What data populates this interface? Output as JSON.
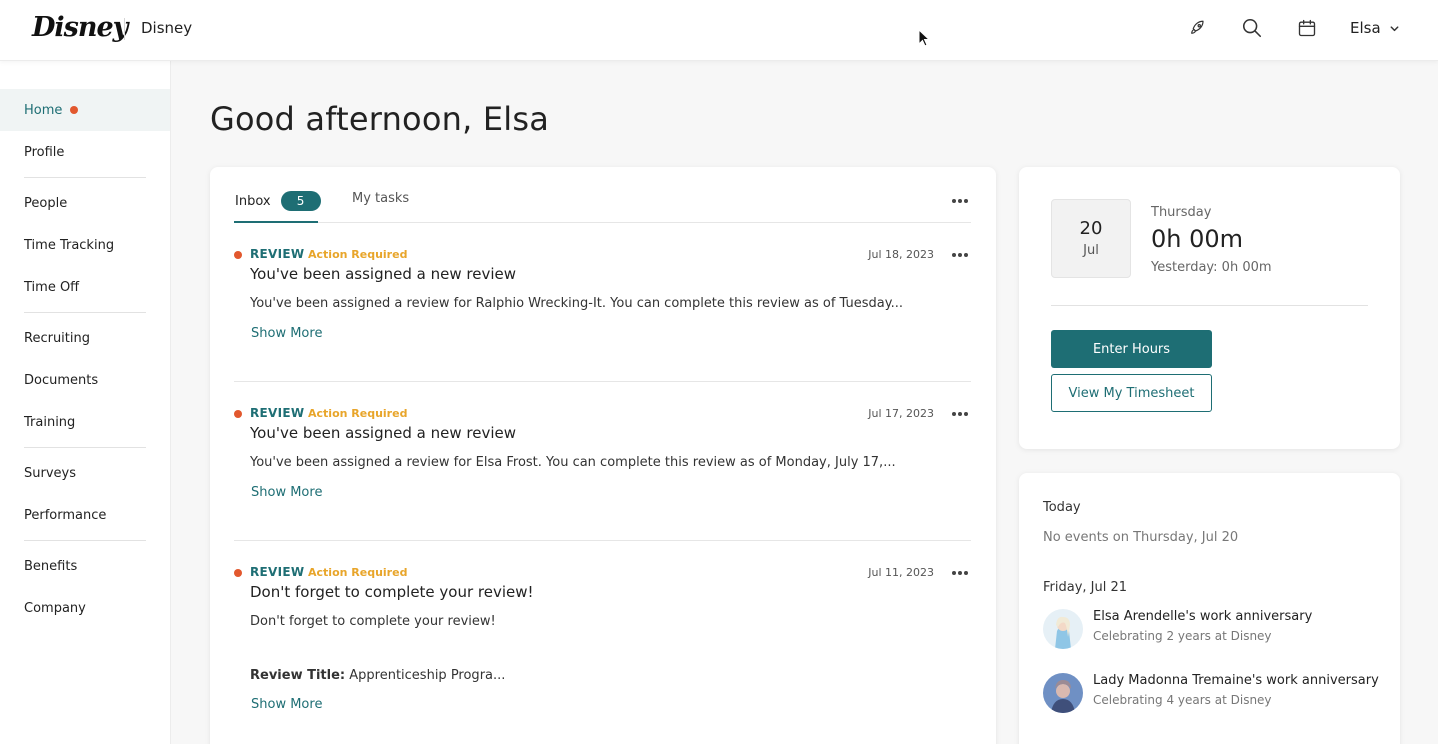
{
  "header": {
    "logo_text": "Disney",
    "brand_name": "Disney",
    "icons": [
      "rocket-icon",
      "search-icon",
      "calendar-icon",
      "chevron-down-icon"
    ],
    "user_name": "Elsa"
  },
  "sidebar": {
    "items": [
      {
        "label": "Home",
        "active": true
      },
      {
        "label": "Profile"
      },
      {
        "label": "People"
      },
      {
        "label": "Time Tracking"
      },
      {
        "label": "Time Off"
      },
      {
        "label": "Recruiting"
      },
      {
        "label": "Documents"
      },
      {
        "label": "Training"
      },
      {
        "label": "Surveys"
      },
      {
        "label": "Performance"
      },
      {
        "label": "Benefits"
      },
      {
        "label": "Company"
      }
    ]
  },
  "main": {
    "greeting": "Good afternoon, Elsa"
  },
  "inbox": {
    "tabs": [
      {
        "label": "Inbox",
        "count": "5",
        "active": true
      },
      {
        "label": "My tasks"
      }
    ],
    "items": [
      {
        "type": "REVIEW",
        "flag": "Action Required",
        "date": "Jul 18, 2023",
        "title": "You've been assigned a new review",
        "body": "You've been assigned a review for Ralphio Wrecking-It. You can complete this review as of Tuesday...",
        "show_more": "Show More"
      },
      {
        "type": "REVIEW",
        "flag": "Action Required",
        "date": "Jul 17, 2023",
        "title": "You've been assigned a new review",
        "body": "You've been assigned a review for Elsa Frost. You can complete this review as of Monday, July 17,...",
        "show_more": "Show More"
      },
      {
        "type": "REVIEW",
        "flag": "Action Required",
        "date": "Jul 11, 2023",
        "title": "Don't forget to complete your review!",
        "body": "Don't forget to complete your review!",
        "extra_label": "Review Title:",
        "extra_value": " Apprenticeship Progra...",
        "show_more": "Show More"
      }
    ]
  },
  "time_tracking": {
    "day": "20",
    "month": "Jul",
    "weekday": "Thursday",
    "hours": "0h 00m",
    "yesterday": "Yesterday: 0h 00m",
    "enter_hours_label": "Enter Hours",
    "view_timesheet_label": "View My Timesheet"
  },
  "events": {
    "today_heading": "Today",
    "today_empty": "No events on Thursday, Jul 20",
    "next_heading": "Friday, Jul 21",
    "items": [
      {
        "title": "Elsa Arendelle's work anniversary",
        "subtitle": "Celebrating 2 years at Disney"
      },
      {
        "title": "Lady Madonna Tremaine's work anniversary",
        "subtitle": "Celebrating 4 years at Disney"
      }
    ]
  },
  "colors": {
    "accent": "#1e6e74",
    "alert_dot": "#e2582e",
    "action_required": "#e8a52a"
  }
}
